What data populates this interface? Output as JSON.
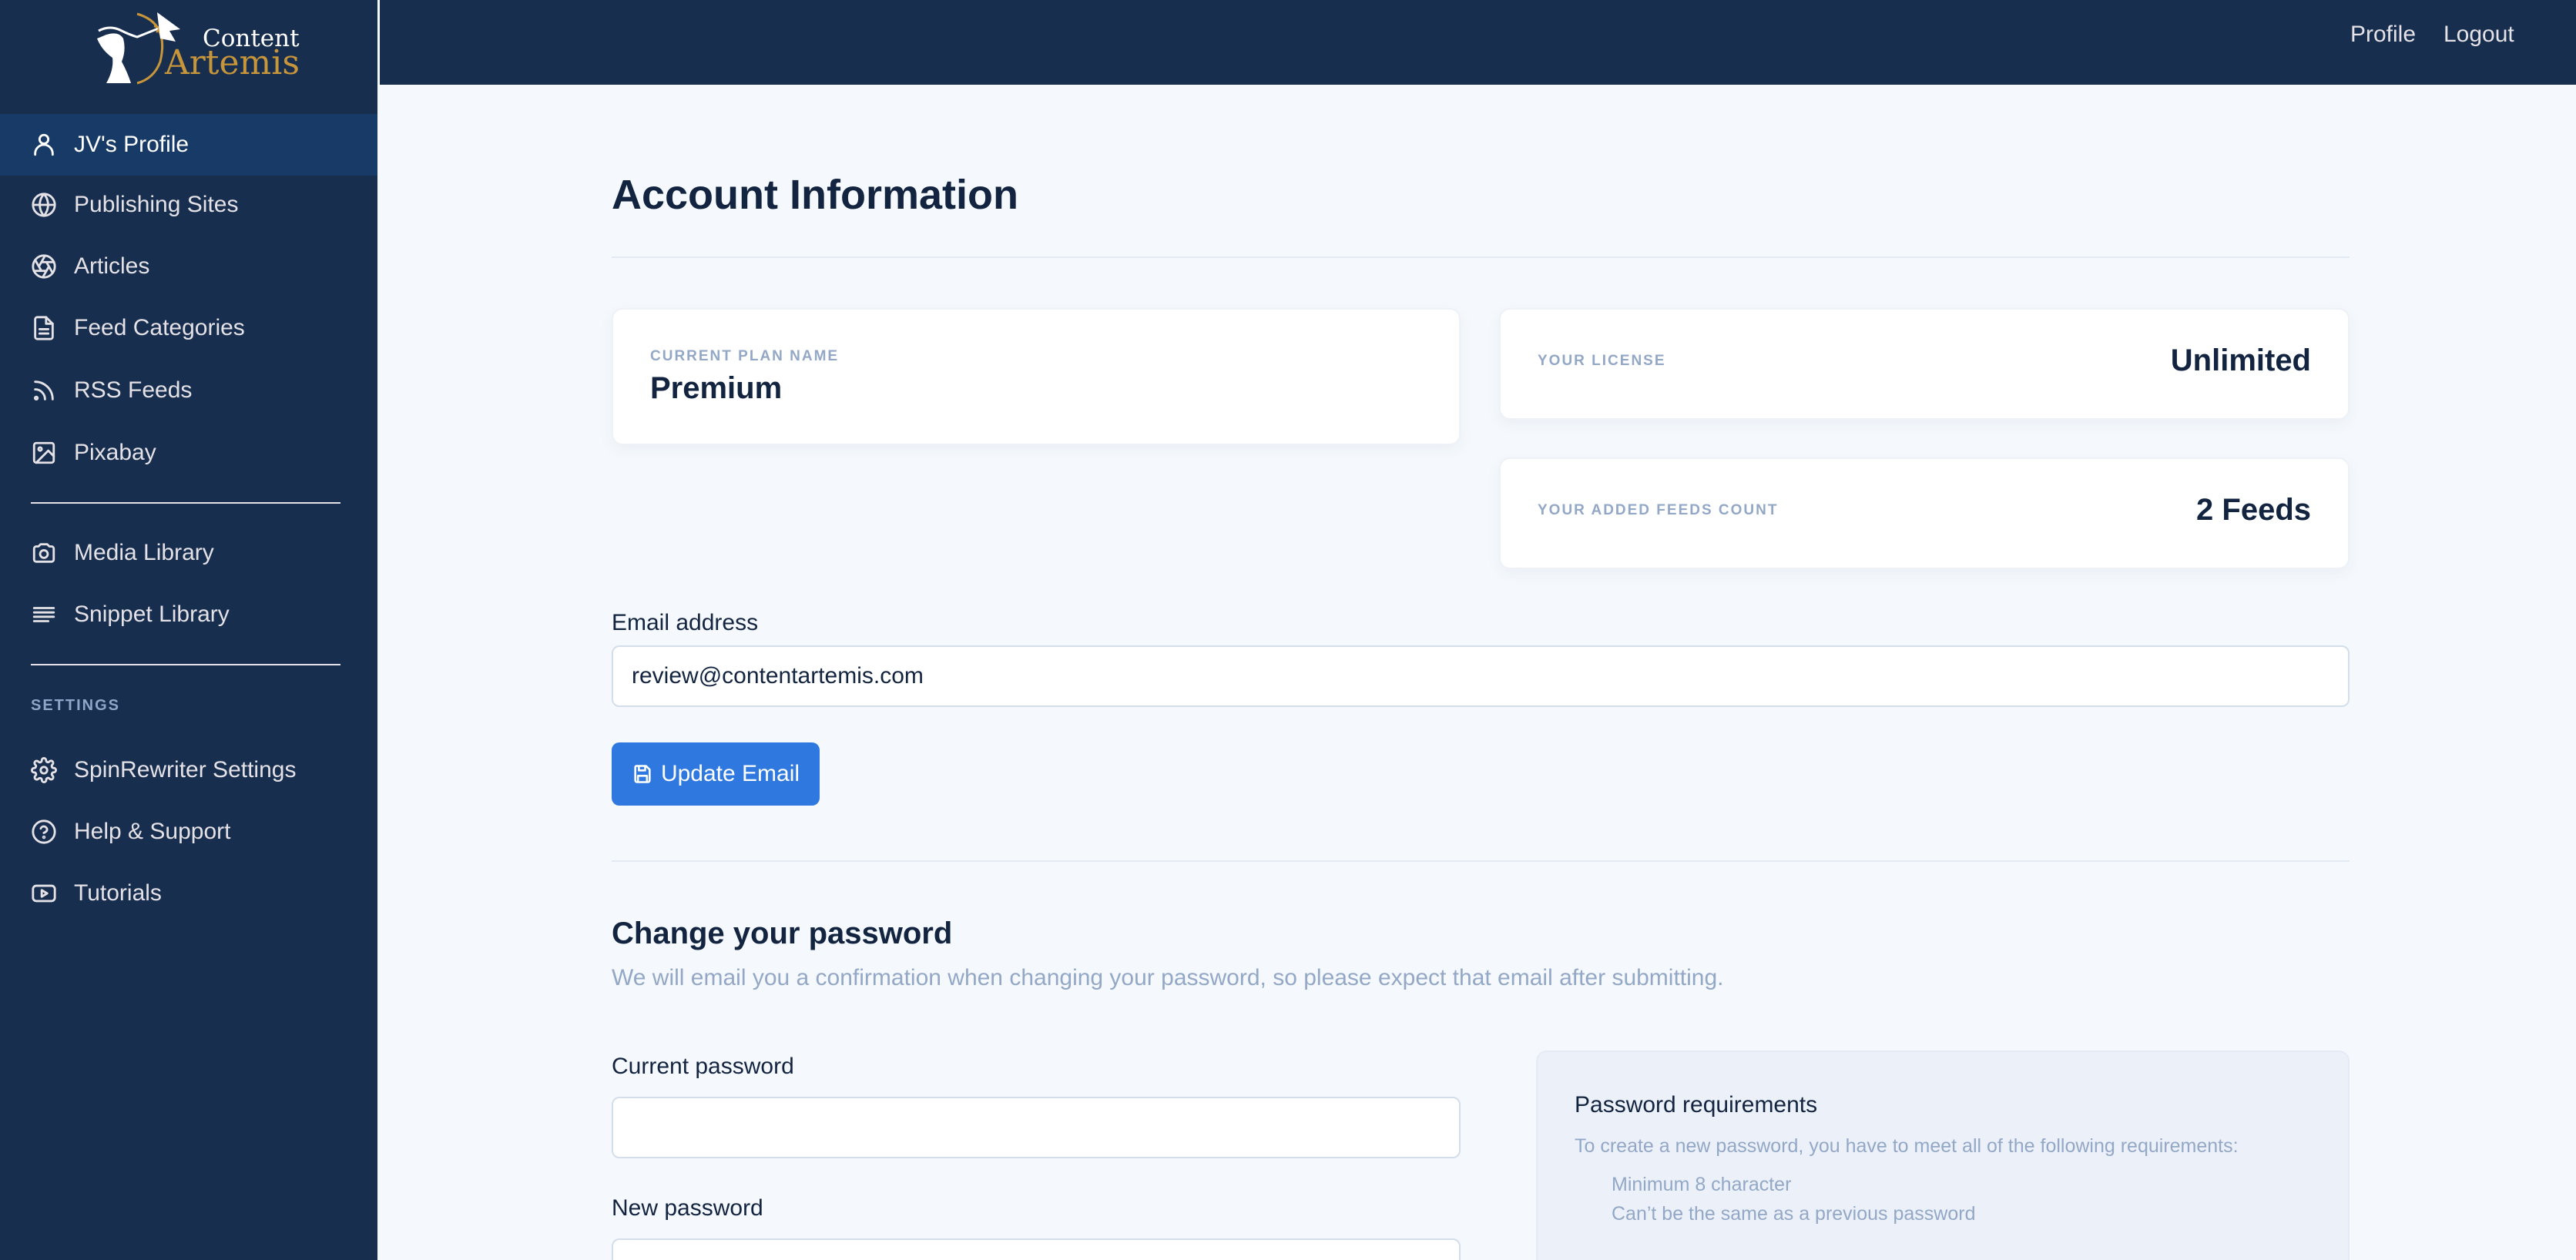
{
  "brand": {
    "line1": "Content",
    "line2": "Artemis",
    "accent_color": "#c8963a"
  },
  "header": {
    "links": [
      {
        "label": "Profile",
        "icon": null
      },
      {
        "label": "Logout",
        "icon": null
      }
    ]
  },
  "sidebar": {
    "items": [
      {
        "label": "JV's Profile",
        "icon": "user-icon",
        "active": true
      },
      {
        "label": "Publishing Sites",
        "icon": "globe-icon",
        "active": false
      },
      {
        "label": "Articles",
        "icon": "aperture-icon",
        "active": false
      },
      {
        "label": "Feed Categories",
        "icon": "document-icon",
        "active": false
      },
      {
        "label": "RSS Feeds",
        "icon": "rss-icon",
        "active": false
      },
      {
        "label": "Pixabay",
        "icon": "image-icon",
        "active": false
      },
      {
        "label": "Media Library",
        "icon": "camera-icon",
        "active": false
      },
      {
        "label": "Snippet Library",
        "icon": "text-lines-icon",
        "active": false
      }
    ],
    "settings_heading": "SETTINGS",
    "settings_items": [
      {
        "label": "SpinRewriter Settings",
        "icon": "gear-icon"
      },
      {
        "label": "Help & Support",
        "icon": "help-circle-icon"
      },
      {
        "label": "Tutorials",
        "icon": "video-play-icon"
      }
    ]
  },
  "main": {
    "title": "Account Information",
    "plan": {
      "label": "Current Plan Name",
      "value": "Premium"
    },
    "license": {
      "label": "Your License",
      "value": "Unlimited"
    },
    "feeds": {
      "label": "Your Added Feeds Count",
      "value": "2 Feeds"
    },
    "email": {
      "label": "Email address",
      "value": "review@contentartemis.com",
      "button": "Update Email",
      "button_icon": "save-icon"
    },
    "password": {
      "title": "Change your password",
      "subtitle": "We will email you a confirmation when changing your password, so please expect that email after submitting.",
      "current_label": "Current password",
      "current_value": "",
      "new_label": "New password",
      "new_value": "",
      "requirements": {
        "title": "Password requirements",
        "description": "To create a new password, you have to meet all of the following requirements:",
        "items": [
          "Minimum 8 character",
          "Can’t be the same as a previous password"
        ]
      }
    }
  },
  "colors": {
    "sidebar_bg": "#172e4f",
    "sidebar_active": "#183a66",
    "primary_button": "#2e78e0",
    "page_bg": "#f5f9fd"
  }
}
